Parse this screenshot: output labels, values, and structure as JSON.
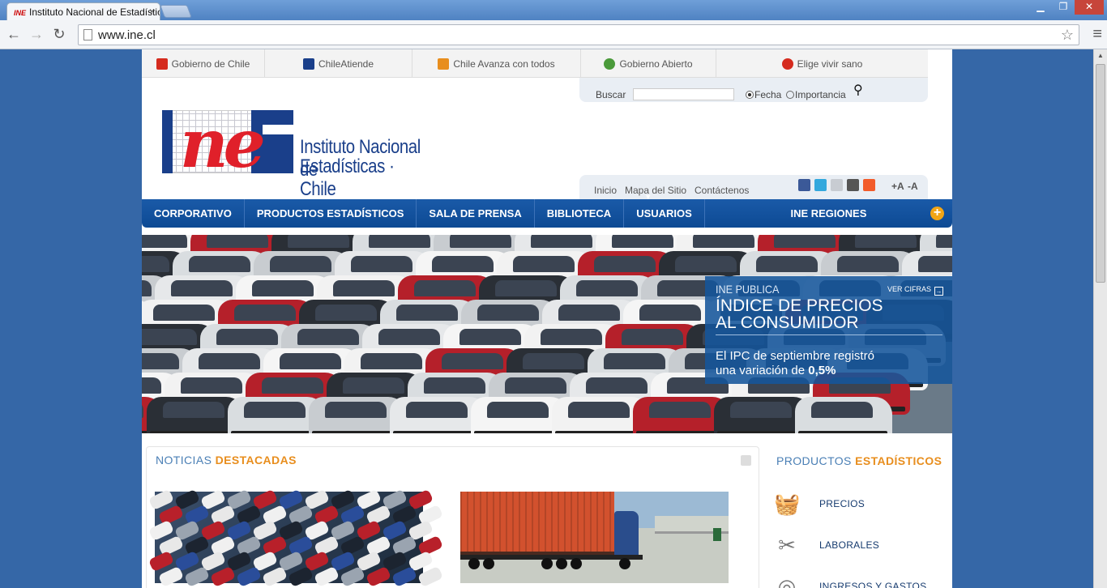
{
  "browser": {
    "tab_title": "Instituto Nacional de Estadísticas",
    "tab_favicon_text": "INE",
    "url": "www.ine.cl"
  },
  "top_links": [
    {
      "label": "Gobierno de Chile",
      "color": "#d52b1e"
    },
    {
      "label": "ChileAtiende",
      "color": "#1a3f8a"
    },
    {
      "label": "Chile Avanza con todos",
      "color": "#e88e1e"
    },
    {
      "label": "Gobierno Abierto",
      "color": "#4a9a3a"
    },
    {
      "label": "Elige vivir sano",
      "color": "#d52b1e"
    }
  ],
  "search": {
    "label": "Buscar",
    "option_1": "Fecha",
    "option_2": "Importancia",
    "selected": "Fecha"
  },
  "logo": {
    "letters": "ne",
    "line1": "Instituto Nacional de",
    "line2": "Estadísticas · Chile"
  },
  "utility": {
    "inicio": "Inicio",
    "mapa": "Mapa del Sitio",
    "contacto": "Contáctenos",
    "font_up": "+A",
    "font_down": "-A"
  },
  "nav": {
    "items": [
      "CORPORATIVO",
      "PRODUCTOS ESTADÍSTICOS",
      "SALA DE PRENSA",
      "BIBLIOTECA",
      "USUARIOS"
    ],
    "regiones": "INE REGIONES"
  },
  "banner": {
    "kicker": "INE PUBLICA",
    "ver_cifras": "VER CIFRAS",
    "title_1": "ÍNDICE DE PRECIOS",
    "title_2": "AL CONSUMIDOR",
    "desc_1": "El IPC de septiembre registró",
    "desc_2a": "una variación de ",
    "desc_2b": "0,5%"
  },
  "news": {
    "title_a": "NOTICIAS",
    "title_b": "DESTACADAS"
  },
  "products": {
    "title_a": "PRODUCTOS",
    "title_b": "ESTADÍSTICOS",
    "items": [
      {
        "label": "PRECIOS",
        "icon": "basket-icon"
      },
      {
        "label": "LABORALES",
        "icon": "tools-icon"
      },
      {
        "label": "INGRESOS Y GASTOS",
        "icon": "coins-icon"
      }
    ]
  }
}
